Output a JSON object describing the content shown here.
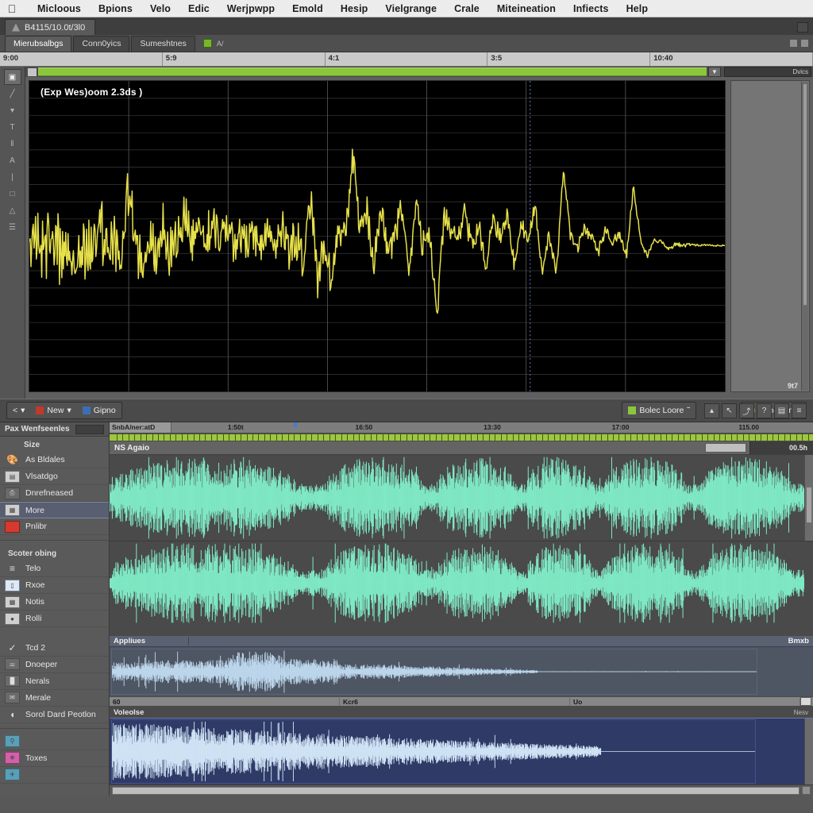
{
  "osmenu": {
    "apple_glyph": "&#63743;",
    "items": [
      "Micloous",
      "Bpions",
      "Velo",
      "Edic",
      "Werjpwpp",
      "Emold",
      "Hesip",
      "Vielgrange",
      "Crale",
      "Miteineation",
      "Infiects",
      "Help"
    ]
  },
  "window": {
    "doc_tab": "B4115/10.0t/3l0",
    "view_tabs": [
      {
        "label": "Mierubsalbgs",
        "active": true
      },
      {
        "label": "Conn0yics",
        "active": false
      },
      {
        "label": "Sumeshtnes",
        "active": false
      }
    ],
    "tab_chip_text": "A/"
  },
  "ruler": {
    "labels": [
      "9:00",
      "5:9",
      "4:1",
      "3:5",
      "10:40"
    ]
  },
  "chart_data": {
    "type": "line",
    "title": "(Exp Wes)oom 2.3ds )",
    "xlabel": "",
    "ylabel": "",
    "series_name": "waveform",
    "color": "#e6e04a",
    "background": "#000000",
    "grid": true,
    "ylim": [
      -1,
      1
    ],
    "xlim": [
      0,
      100
    ],
    "note": "damped oscillatory seismic/audio trace decaying to zero on the right",
    "values": [
      0.1,
      0.06,
      -0.02,
      0.04,
      0.0,
      -0.12,
      -0.04,
      -0.18,
      0.02,
      -0.1,
      0.26,
      -0.04,
      0.1,
      -0.14,
      0.58,
      0.04,
      -0.22,
      0.04,
      -0.06,
      0.14,
      -0.04,
      0.06,
      0.32,
      0.02,
      0.16,
      -0.02,
      0.22,
      0.06,
      0.2,
      -0.02,
      0.14,
      0.02,
      0.16,
      -0.1,
      0.12,
      0.0,
      0.14,
      -0.04,
      0.08,
      -0.18,
      0.48,
      -0.34,
      0.06,
      -0.36,
      0.2,
      0.06,
      0.96,
      0.2,
      0.38,
      -0.2,
      0.44,
      -0.12,
      0.1,
      0.38,
      -0.3,
      0.46,
      -0.02,
      0.12,
      -0.74,
      0.28,
      0.18,
      0.04,
      0.34,
      0.0,
      0.16,
      -0.22,
      0.28,
      0.06,
      0.34,
      -0.2,
      0.22,
      0.06,
      0.42,
      -0.26,
      0.14,
      -0.3,
      0.76,
      0.12,
      -0.02,
      0.18,
      0.08,
      -0.06,
      0.16,
      0.02,
      0.12,
      -0.1,
      0.6,
      0.04,
      -0.1,
      0.06,
      0.04,
      -0.04,
      0.02,
      0.0,
      0.01,
      0.0,
      0.01,
      0.0,
      0.0,
      0.0
    ],
    "cursor_x_pct": 72,
    "second_chart_note": "no second axis"
  },
  "chart_panel": {
    "right_label": "Dvics",
    "corner_label": "9t7"
  },
  "toolbar": {
    "back_label": "<",
    "back_caret": "▾",
    "new_label": "New",
    "new_caret": "▾",
    "open_label": "Gipno",
    "bolec_label": "Bolec Loore",
    "bolec_caret": "˜",
    "icon_a": "⚒",
    "icon_search": "⚲",
    "volume_label": "Iclme liome",
    "right_icons": [
      "▴",
      "↖",
      "⤴",
      "?",
      "▤",
      "≡"
    ]
  },
  "sidebar": {
    "header_title": "Pax Wenfseenles",
    "header_caret": "··",
    "group1_title": "Size",
    "group1": [
      {
        "label": "As Bldales",
        "icon": "palette-icon",
        "style": "none"
      },
      {
        "label": "Vlsatdgo",
        "icon": "image-icon",
        "style": "plain"
      },
      {
        "label": "Dnrefneased",
        "icon": "printer-icon",
        "style": "dark"
      },
      {
        "label": "More",
        "icon": "layers-icon",
        "style": "plain",
        "selected": true
      },
      {
        "label": "Pnlibr",
        "icon": "color-swatch-icon",
        "style": "red"
      }
    ],
    "group2_title": "Scoter obing",
    "group2": [
      {
        "label": "Telo",
        "icon": "equals-icon",
        "style": "none"
      },
      {
        "label": "Rxoe",
        "icon": "page-icon",
        "style": "blue"
      },
      {
        "label": "Notis",
        "icon": "grid-icon",
        "style": "plain"
      },
      {
        "label": "Rolli",
        "icon": "circle-icon",
        "style": "plain"
      }
    ],
    "group3": [
      {
        "label": "Tcd 2",
        "icon": "check-icon",
        "style": "none"
      },
      {
        "label": "Dnoeper",
        "icon": "slider-icon",
        "style": "dark"
      },
      {
        "label": "Nerals",
        "icon": "wave-icon",
        "style": "dark"
      },
      {
        "label": "Merale",
        "icon": "envelope-icon",
        "style": "dark"
      },
      {
        "label": "Sorol Dard Peotlon",
        "icon": "contrast-icon",
        "style": "none"
      }
    ],
    "group4": [
      {
        "label": "",
        "icon": "pin-icon",
        "style": "teal"
      },
      {
        "label": "Toxes",
        "icon": "flower-icon",
        "style": "pink"
      },
      {
        "label": "",
        "icon": "bird-icon",
        "style": "teal"
      }
    ]
  },
  "timeline": {
    "tag": "SnbA/ner:atD",
    "marks": [
      "1:50t",
      "16:50",
      "13:30",
      "17:00",
      "115.00"
    ]
  },
  "track": {
    "name": "NS Agaio",
    "time_readout": "00.5h"
  },
  "tracks_waveform": {
    "color": "#7fe8c4",
    "background": "#4a4a4a",
    "channels": 2
  },
  "bottom_panel_a": {
    "left_label": "Appliues",
    "right_label": "Bmxb",
    "wave_color": "#bcd6ec",
    "background": "#4e5663"
  },
  "mini_ruler": {
    "labels": [
      "60",
      "Kcr6",
      "Uo"
    ]
  },
  "bottom_panel_b": {
    "label": "Voleolse",
    "right_label": "Nesv",
    "wave_color": "#cfe3f5",
    "background": "#2f3a66"
  }
}
